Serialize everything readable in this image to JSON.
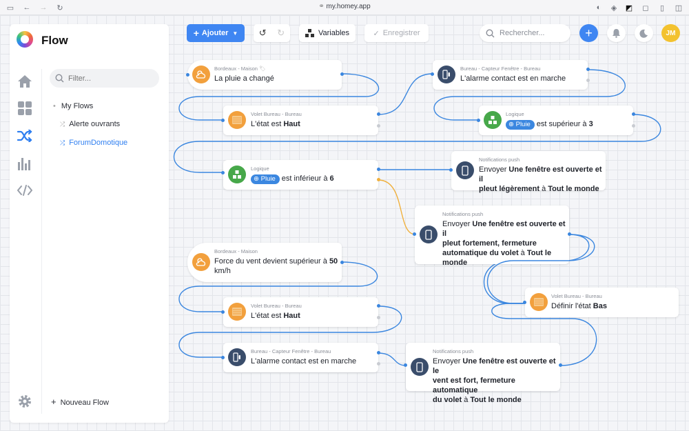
{
  "browser": {
    "url": "my.homey.app"
  },
  "app": {
    "title": "Flow"
  },
  "sidebar": {
    "filter_placeholder": "Filter...",
    "tree": {
      "root": "My Flows",
      "items": [
        "Alerte ouvrants",
        "ForumDomotique"
      ]
    },
    "new_flow": "Nouveau Flow"
  },
  "toolbar": {
    "add": "Ajouter",
    "variables": "Variables",
    "save": "Enregistrer",
    "search_placeholder": "Rechercher...",
    "avatar": "JM"
  },
  "cards": {
    "c1": {
      "sub": "Bordeaux - Maison",
      "text": "La pluie a changé"
    },
    "c2": {
      "sub": "Volet Bureau - Bureau",
      "pre": "L'état est ",
      "bold": "Haut"
    },
    "c3": {
      "sub": "Bureau - Capteur Fenêtre - Bureau",
      "text": "L'alarme contact est en marche"
    },
    "c4": {
      "sub": "Logique",
      "pill": "Pluie",
      "mid": " est supérieur à ",
      "bold": "3"
    },
    "c5": {
      "sub": "Logique",
      "pill": "Pluie",
      "mid": " est inférieur à ",
      "bold": "6"
    },
    "c6": {
      "sub": "Notifications push",
      "l1a": "Envoyer ",
      "l1b": "Une fenêtre est ouverte et il",
      "l2b": "pleut légèrement",
      "l2c": " à ",
      "l2d": "Tout le monde"
    },
    "c7": {
      "sub": "Notifications push",
      "l1a": "Envoyer ",
      "l1b": "Une fenêtre est ouverte et il",
      "l2": "pleut fortement, fermeture",
      "l3": "automatique du volet",
      "l3c": " à ",
      "l3d": "Tout le",
      "l4": "monde"
    },
    "c8": {
      "sub": "Bordeaux - Maison",
      "l1a": "Force du vent devient supérieur à ",
      "l1b": "50",
      "l2": "km/h"
    },
    "c9": {
      "sub": "Volet Bureau - Bureau",
      "pre": "Définir l'état ",
      "bold": "Bas"
    },
    "c10": {
      "sub": "Volet Bureau - Bureau",
      "pre": "L'état est ",
      "bold": "Haut"
    },
    "c11": {
      "sub": "Bureau - Capteur Fenêtre - Bureau",
      "text": "L'alarme contact est en marche"
    },
    "c12": {
      "sub": "Notifications push",
      "l1a": "Envoyer ",
      "l1b": "Une fenêtre est ouverte et le",
      "l2": "vent est fort, fermeture automatique",
      "l3": "du volet",
      "l3c": " à ",
      "l3d": "Tout le monde"
    }
  },
  "colors": {
    "accent": "#2f7ff0",
    "wire": "#3a86df",
    "wire_false": "#f0b03c",
    "green": "#47a84a",
    "orange": "#f2a03d",
    "navy": "#3a4d6b"
  }
}
